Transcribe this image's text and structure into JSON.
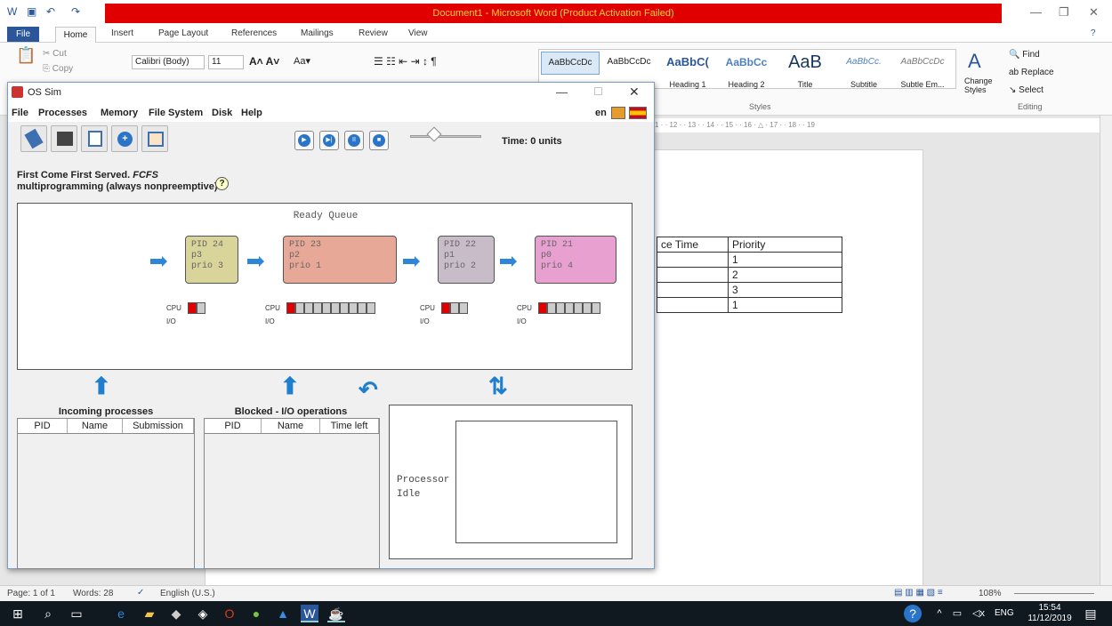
{
  "word": {
    "title": "Document1  -  Microsoft Word (Product Activation Failed)",
    "tabs": [
      "File",
      "Home",
      "Insert",
      "Page Layout",
      "References",
      "Mailings",
      "Review",
      "View"
    ],
    "clipboard": {
      "cut": "Cut",
      "copy": "Copy",
      "paste": "Paste"
    },
    "font": {
      "name": "Calibri (Body)",
      "size": "11"
    },
    "styles": [
      {
        "preview": "AaBbCcDc",
        "name": ""
      },
      {
        "preview": "AaBbCcDc",
        "name": ""
      },
      {
        "preview": "AaBbC(",
        "name": "Heading 1"
      },
      {
        "preview": "AaBbCc",
        "name": "Heading 2"
      },
      {
        "preview": "AaB",
        "name": "Title"
      },
      {
        "preview": "AaBbCc.",
        "name": "Subtitle"
      },
      {
        "preview": "AaBbCcDc",
        "name": "Subtle Em..."
      }
    ],
    "change_styles": "Change Styles",
    "styles_group": "Styles",
    "editing": {
      "find": "Find",
      "replace": "Replace",
      "select": "Select",
      "group": "Editing"
    },
    "ruler_text": "1 · · 12 · · 13 · · 14 · · 15 · · 16 · △ · 17 · · 18 · · 19",
    "table": {
      "headers": [
        "ce Time",
        "Priority"
      ],
      "rows": [
        [
          "",
          "1"
        ],
        [
          "",
          "2"
        ],
        [
          "",
          "3"
        ],
        [
          "",
          "1"
        ]
      ]
    },
    "status": {
      "page": "Page: 1 of 1",
      "words": "Words: 28",
      "lang": "English (U.S.)",
      "zoom": "108%"
    },
    "taskbar": {
      "time": "15:54",
      "date": "11/12/2019",
      "lang": "ENG"
    }
  },
  "ossim": {
    "title": "OS Sim",
    "menu": [
      "File",
      "Processes",
      "Memory",
      "File System",
      "Disk",
      "Help"
    ],
    "lang": "en",
    "time": "Time: 0 units",
    "algo_line1": "First Come First Served. ",
    "algo_italic": "FCFS",
    "algo_line2": "multiprogramming (always nonpreemptive)",
    "help": "?",
    "ready_queue": "Ready Queue",
    "processes": [
      {
        "pid": "PID 24",
        "name": "p3",
        "prio": "prio 3",
        "color": "#d8d49a",
        "cpu_total": 2,
        "cpu_done": 1
      },
      {
        "pid": "PID 23",
        "name": "p2",
        "prio": "prio 1",
        "color": "#e8a898",
        "cpu_total": 10,
        "cpu_done": 1
      },
      {
        "pid": "PID 22",
        "name": "p1",
        "prio": "prio 2",
        "color": "#c8bcc8",
        "cpu_total": 3,
        "cpu_done": 1
      },
      {
        "pid": "PID 21",
        "name": "p0",
        "prio": "prio 4",
        "color": "#e8a0d0",
        "cpu_total": 7,
        "cpu_done": 1
      }
    ],
    "cpu_label": "CPU",
    "io_label": "I/O",
    "incoming": {
      "title": "Incoming processes",
      "cols": [
        "PID",
        "Name",
        "Submission"
      ]
    },
    "blocked": {
      "title": "Blocked - I/O operations",
      "cols": [
        "PID",
        "Name",
        "Time left"
      ]
    },
    "processor": {
      "line1": "Processor",
      "line2": "Idle"
    }
  }
}
